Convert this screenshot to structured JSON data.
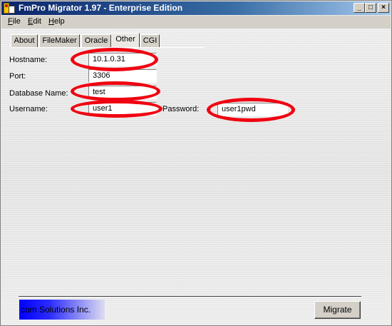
{
  "window": {
    "title": "FmPro Migrator 1.97 - Enterprise Edition",
    "min_glyph": "_",
    "max_glyph": "□",
    "close_glyph": "×"
  },
  "menu": [
    {
      "label": "File"
    },
    {
      "label": "Edit"
    },
    {
      "label": "Help"
    }
  ],
  "tabs": [
    {
      "label": "About",
      "active": false
    },
    {
      "label": "FileMaker",
      "active": false
    },
    {
      "label": "Oracle",
      "active": false
    },
    {
      "label": "Other",
      "active": true
    },
    {
      "label": "CGI",
      "active": false
    }
  ],
  "form": {
    "hostname_label": "Hostname:",
    "hostname_value": "10.1.0.31",
    "port_label": "Port:",
    "port_value": "3306",
    "dbname_label": "Database Name:",
    "dbname_value": "test",
    "username_label": "Username:",
    "username_value": "user1",
    "password_label": "Password:",
    "password_value": "user1pwd"
  },
  "footer": {
    "brand_text": "com Solutions Inc.",
    "migrate_label": "Migrate"
  },
  "colors": {
    "highlight_ring": "#f00010",
    "title_bar": "#0a246a"
  }
}
